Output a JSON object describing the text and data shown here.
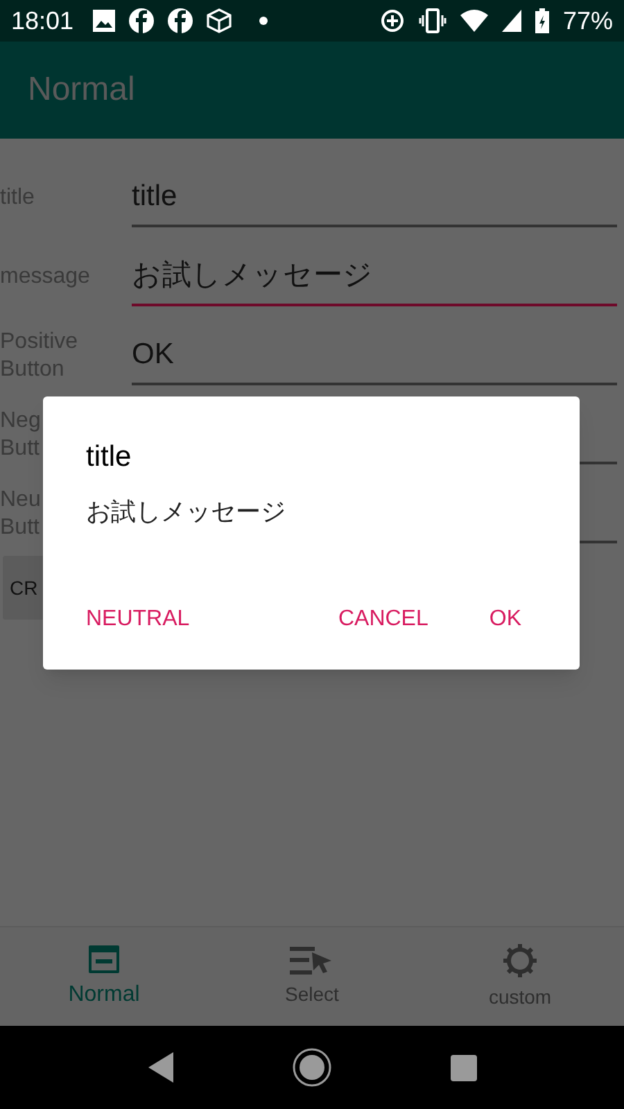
{
  "status_bar": {
    "time": "18:01",
    "battery": "77%"
  },
  "app_bar": {
    "title": "Normal"
  },
  "form": [
    {
      "label": [
        "title"
      ],
      "value": "title",
      "focused": false
    },
    {
      "label": [
        "message"
      ],
      "value": "お試しメッセージ",
      "focused": true
    },
    {
      "label": [
        "Positive",
        "Button"
      ],
      "value": "OK",
      "focused": false
    },
    {
      "label": [
        "Neg",
        "Butt"
      ],
      "focused": false
    },
    {
      "label": [
        "Neu",
        "Butt"
      ],
      "focused": false
    }
  ],
  "action_button": "CR",
  "dialog": {
    "title": "title",
    "message": "お試しメッセージ",
    "buttons": [
      {
        "kind": "neutral",
        "label": "NEUTRAL"
      },
      {
        "kind": "negative",
        "label": "CANCEL"
      },
      {
        "kind": "positive",
        "label": "OK"
      }
    ]
  },
  "bottom_nav": [
    {
      "label": "Normal",
      "selected": true
    },
    {
      "label": "Select",
      "selected": false
    },
    {
      "label": "custom",
      "selected": false
    }
  ]
}
